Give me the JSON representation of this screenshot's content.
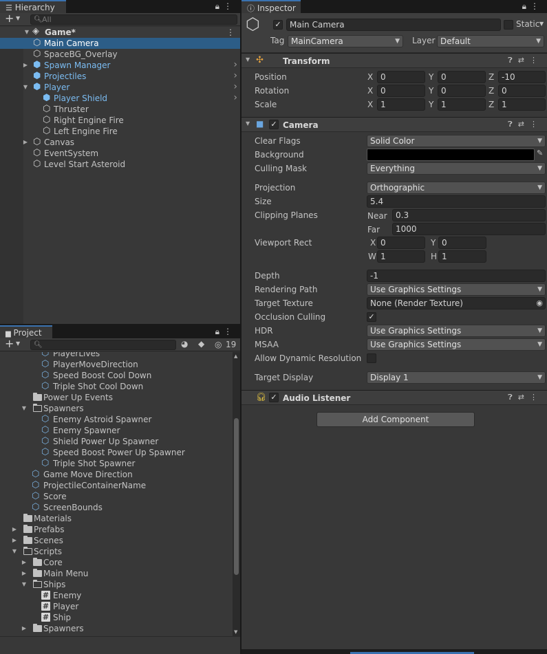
{
  "hierarchy": {
    "tab_label": "Hierarchy",
    "add_label": "+",
    "search_placeholder": "All",
    "scene_name": "Game*",
    "items": [
      {
        "label": "Main Camera",
        "prefab": false,
        "selected": true,
        "depth": 1,
        "fold": "",
        "has_arrow": false
      },
      {
        "label": "SpaceBG_Overlay",
        "prefab": false,
        "selected": false,
        "depth": 1,
        "fold": "",
        "has_arrow": false
      },
      {
        "label": "Spawn Manager",
        "prefab": true,
        "selected": false,
        "depth": 1,
        "fold": "closed",
        "has_arrow": true
      },
      {
        "label": "Projectiles",
        "prefab": true,
        "selected": false,
        "depth": 1,
        "fold": "",
        "has_arrow": true
      },
      {
        "label": "Player",
        "prefab": true,
        "selected": false,
        "depth": 1,
        "fold": "open",
        "has_arrow": true
      },
      {
        "label": "Player Shield",
        "prefab": true,
        "selected": false,
        "depth": 2,
        "fold": "",
        "has_arrow": true
      },
      {
        "label": "Thruster",
        "prefab": false,
        "selected": false,
        "depth": 2,
        "fold": "",
        "has_arrow": false
      },
      {
        "label": "Right Engine Fire",
        "prefab": false,
        "selected": false,
        "depth": 2,
        "fold": "",
        "has_arrow": false
      },
      {
        "label": "Left  Engine Fire",
        "prefab": false,
        "selected": false,
        "depth": 2,
        "fold": "",
        "has_arrow": false
      },
      {
        "label": "Canvas",
        "prefab": false,
        "selected": false,
        "depth": 1,
        "fold": "closed",
        "has_arrow": false
      },
      {
        "label": "EventSystem",
        "prefab": false,
        "selected": false,
        "depth": 1,
        "fold": "",
        "has_arrow": false
      },
      {
        "label": "Level Start Asteroid",
        "prefab": false,
        "selected": false,
        "depth": 1,
        "fold": "",
        "has_arrow": false
      }
    ]
  },
  "project": {
    "tab_label": "Project",
    "add_label": "+",
    "hidden_count": "19",
    "items": [
      {
        "label": "PlayerLives",
        "kind": "so",
        "indent": 60,
        "fold": ""
      },
      {
        "label": "PlayerMoveDirection",
        "kind": "so",
        "indent": 60,
        "fold": ""
      },
      {
        "label": "Speed Boost Cool Down",
        "kind": "so",
        "indent": 60,
        "fold": ""
      },
      {
        "label": "Triple Shot Cool Down",
        "kind": "so",
        "indent": 60,
        "fold": ""
      },
      {
        "label": "Power Up Events",
        "kind": "folder",
        "indent": 46,
        "fold": ""
      },
      {
        "label": "Spawners",
        "kind": "folder-open",
        "indent": 46,
        "fold": "open"
      },
      {
        "label": "Enemy Astroid Spawner",
        "kind": "so",
        "indent": 60,
        "fold": ""
      },
      {
        "label": "Enemy Spawner",
        "kind": "so",
        "indent": 60,
        "fold": ""
      },
      {
        "label": "Shield Power Up Spawner",
        "kind": "so",
        "indent": 60,
        "fold": ""
      },
      {
        "label": "Speed Boost Power Up Spawner",
        "kind": "so",
        "indent": 60,
        "fold": ""
      },
      {
        "label": "Triple Shot Spawner",
        "kind": "so",
        "indent": 60,
        "fold": ""
      },
      {
        "label": "Game Move Direction",
        "kind": "so",
        "indent": 46,
        "fold": ""
      },
      {
        "label": "ProjectileContainerName",
        "kind": "so",
        "indent": 46,
        "fold": ""
      },
      {
        "label": "Score",
        "kind": "so",
        "indent": 46,
        "fold": ""
      },
      {
        "label": "ScreenBounds",
        "kind": "so",
        "indent": 46,
        "fold": ""
      },
      {
        "label": "Materials",
        "kind": "folder",
        "indent": 32,
        "fold": ""
      },
      {
        "label": "Prefabs",
        "kind": "folder",
        "indent": 32,
        "fold": "closed"
      },
      {
        "label": "Scenes",
        "kind": "folder",
        "indent": 32,
        "fold": "closed"
      },
      {
        "label": "Scripts",
        "kind": "folder-open",
        "indent": 32,
        "fold": "open"
      },
      {
        "label": "Core",
        "kind": "folder",
        "indent": 46,
        "fold": "closed"
      },
      {
        "label": "Main Menu",
        "kind": "folder",
        "indent": 46,
        "fold": "closed"
      },
      {
        "label": "Ships",
        "kind": "folder-open",
        "indent": 46,
        "fold": "open"
      },
      {
        "label": "Enemy",
        "kind": "script",
        "indent": 60,
        "fold": ""
      },
      {
        "label": "Player",
        "kind": "script",
        "indent": 60,
        "fold": ""
      },
      {
        "label": "Ship",
        "kind": "script",
        "indent": 60,
        "fold": ""
      },
      {
        "label": "Spawners",
        "kind": "folder",
        "indent": 46,
        "fold": "closed"
      }
    ]
  },
  "inspector": {
    "tab_label": "Inspector",
    "object_name": "Main Camera",
    "static_label": "Static",
    "tag_label": "Tag",
    "tag_value": "MainCamera",
    "layer_label": "Layer",
    "layer_value": "Default",
    "transform": {
      "title": "Transform",
      "position_label": "Position",
      "rotation_label": "Rotation",
      "scale_label": "Scale",
      "position": {
        "x": "0",
        "y": "0",
        "z": "-10"
      },
      "rotation": {
        "x": "0",
        "y": "0",
        "z": "0"
      },
      "scale": {
        "x": "1",
        "y": "1",
        "z": "1"
      }
    },
    "camera": {
      "title": "Camera",
      "clear_flags_label": "Clear Flags",
      "clear_flags": "Solid Color",
      "background_label": "Background",
      "background_color": "#000000",
      "culling_mask_label": "Culling Mask",
      "culling_mask": "Everything",
      "projection_label": "Projection",
      "projection": "Orthographic",
      "size_label": "Size",
      "size": "5.4",
      "clipping_label": "Clipping Planes",
      "near_label": "Near",
      "near": "0.3",
      "far_label": "Far",
      "far": "1000",
      "viewport_label": "Viewport Rect",
      "vx": "0",
      "vy": "0",
      "vw": "1",
      "vh": "1",
      "depth_label": "Depth",
      "depth": "-1",
      "rendering_path_label": "Rendering Path",
      "rendering_path": "Use Graphics Settings",
      "target_texture_label": "Target Texture",
      "target_texture": "None (Render Texture)",
      "occlusion_label": "Occlusion Culling",
      "hdr_label": "HDR",
      "hdr": "Use Graphics Settings",
      "msaa_label": "MSAA",
      "msaa": "Use Graphics Settings",
      "dynres_label": "Allow Dynamic Resolution",
      "target_display_label": "Target Display",
      "target_display": "Display 1"
    },
    "audio_listener": {
      "title": "Audio Listener"
    },
    "add_component_label": "Add Component"
  },
  "colors": {
    "accent": "#3a72b0",
    "selection": "#2c5d87",
    "prefab_text": "#7bbcf2"
  }
}
